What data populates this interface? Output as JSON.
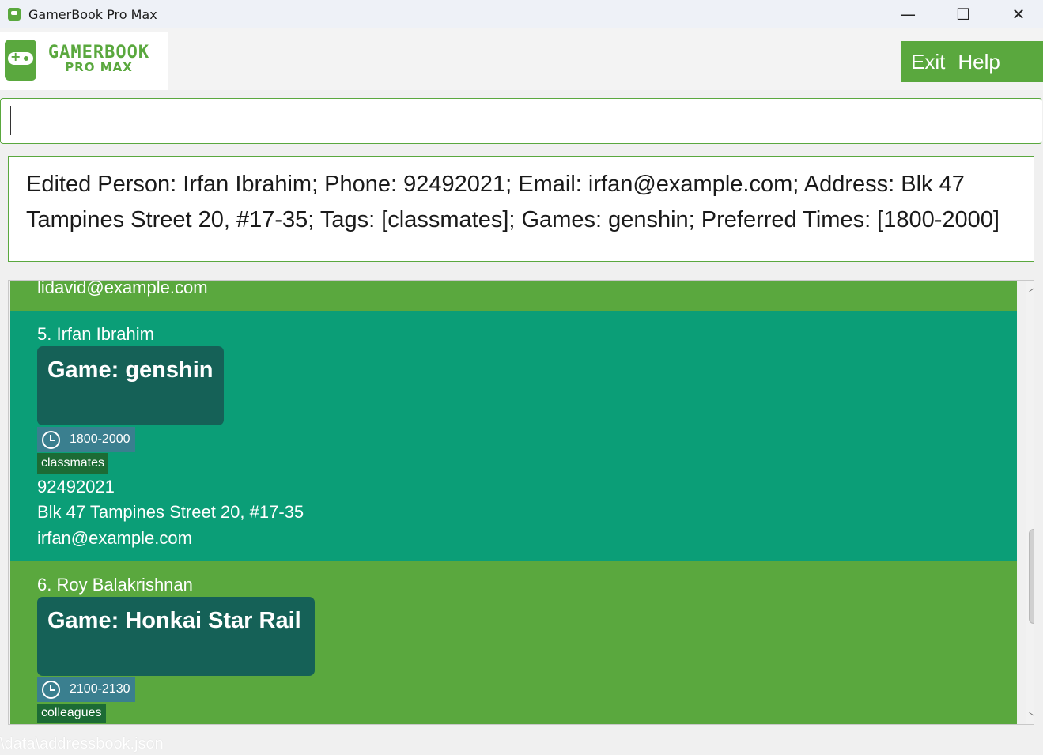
{
  "window": {
    "title": "GamerBook Pro Max",
    "minimize": "—",
    "maximize": "☐",
    "close": "✕"
  },
  "logo": {
    "line1": "GAMERBOOK",
    "line2": "PRO MAX"
  },
  "menu": {
    "exit": "Exit",
    "help": "Help"
  },
  "command": {
    "value": ""
  },
  "result": {
    "text": "Edited Person: Irfan Ibrahim; Phone: 92492021; Email: irfan@example.com; Address: Blk 47 Tampines Street 20, #17-35; Tags: [classmates]; Games: genshin; Preferred Times: [1800-2000]"
  },
  "persons": [
    {
      "email": "lidavid@example.com"
    },
    {
      "name": "5. Irfan Ibrahim",
      "game": "Game: genshin",
      "time": "1800-2000",
      "tag": "classmates",
      "phone": "92492021",
      "address": "Blk 47 Tampines Street 20, #17-35",
      "email": "irfan@example.com"
    },
    {
      "name": "6. Roy Balakrishnan",
      "game": "Game: Honkai Star Rail",
      "time": "2100-2130",
      "tag": "colleagues"
    }
  ],
  "status": {
    "path": "\\data\\addressbook.json"
  },
  "colors": {
    "accent": "#5aa83e",
    "selected": "#0b9e77",
    "game_card": "#156157"
  }
}
